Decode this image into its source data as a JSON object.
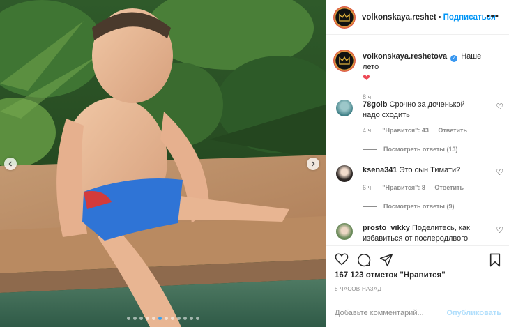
{
  "post": {
    "author": "volkonskaya.reshet",
    "header_separator": "•",
    "follow_label": "Подписаться",
    "more_label": "•••"
  },
  "caption": {
    "username": "volkonskaya.reshetova",
    "text": "Наше лето",
    "emoji": "❤",
    "time": "8 ч."
  },
  "comments": [
    {
      "username": "78golb",
      "text": "Срочно за доченькой надо сходить",
      "time": "4 ч.",
      "likes": "\"Нравится\": 43",
      "reply": "Ответить",
      "replies": "Посмотреть ответы (13)"
    },
    {
      "username": "ksena341",
      "text": "Это сын Тимати?",
      "time": "6 ч.",
      "likes": "\"Нравится\": 8",
      "reply": "Ответить",
      "replies": "Посмотреть ответы (9)"
    },
    {
      "username": "prosto_vikky",
      "text": "Поделитесь, как избавиться от послеродлвого"
    }
  ],
  "stats": {
    "likes": "167 123 отметок \"Нравится\"",
    "posted": "8 ЧАСОВ НАЗАД"
  },
  "add_comment": {
    "placeholder": "Добавьте комментарий...",
    "publish_label": "Опубликовать"
  },
  "carousel": {
    "total_dots": 12,
    "active_index": 5
  },
  "colors": {
    "accent": "#0095f6",
    "verified": "#3897f0",
    "heart": "#ed4956"
  }
}
